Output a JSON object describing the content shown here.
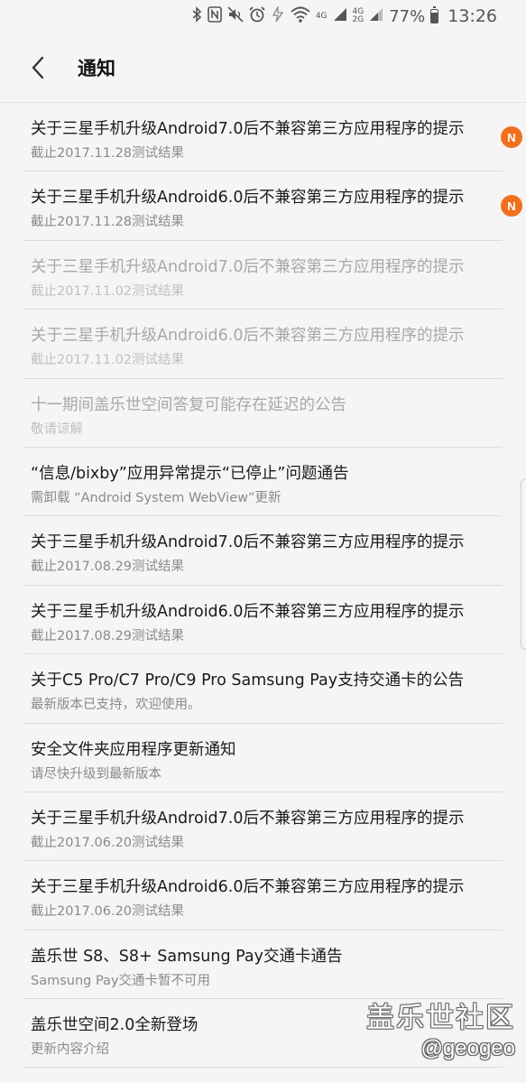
{
  "status_bar": {
    "battery_percent": "77%",
    "battery_level": 0.77,
    "network_top": "4G",
    "network_mid": "4G",
    "network_bottom": "2G",
    "time": "13:26",
    "icons": [
      "bluetooth-icon",
      "nfc-icon",
      "mute-icon",
      "alarm-icon",
      "data-saver-icon",
      "wifi-icon",
      "signal-4g-icon",
      "signal-2g-icon",
      "battery-icon"
    ]
  },
  "header": {
    "title": "通知",
    "back_icon": "chevron-left-icon"
  },
  "notifications": [
    {
      "title": "关于三星手机升级Android7.0后不兼容第三方应用程序的提示",
      "subtitle": "截止2017.11.28测试结果",
      "read": false,
      "badge": "N"
    },
    {
      "title": "关于三星手机升级Android6.0后不兼容第三方应用程序的提示",
      "subtitle": "截止2017.11.28测试结果",
      "read": false,
      "badge": "N"
    },
    {
      "title": "关于三星手机升级Android7.0后不兼容第三方应用程序的提示",
      "subtitle": "截止2017.11.02测试结果",
      "read": true,
      "badge": ""
    },
    {
      "title": "关于三星手机升级Android6.0后不兼容第三方应用程序的提示",
      "subtitle": "截止2017.11.02测试结果",
      "read": true,
      "badge": ""
    },
    {
      "title": "十一期间盖乐世空间答复可能存在延迟的公告",
      "subtitle": "敬请谅解",
      "read": true,
      "badge": ""
    },
    {
      "title": "“信息/bixby”应用异常提示“已停止”问题通告",
      "subtitle": "需卸载 “Android System WebView”更新",
      "read": false,
      "badge": ""
    },
    {
      "title": "关于三星手机升级Android7.0后不兼容第三方应用程序的提示",
      "subtitle": "截止2017.08.29测试结果",
      "read": false,
      "badge": ""
    },
    {
      "title": "关于三星手机升级Android6.0后不兼容第三方应用程序的提示",
      "subtitle": "截止2017.08.29测试结果",
      "read": false,
      "badge": ""
    },
    {
      "title": "关于C5 Pro/C7 Pro/C9 Pro Samsung Pay支持交通卡的公告",
      "subtitle": "最新版本已支持，欢迎使用。",
      "read": false,
      "badge": ""
    },
    {
      "title": "安全文件夹应用程序更新通知",
      "subtitle": "请尽快升级到最新版本",
      "read": false,
      "badge": ""
    },
    {
      "title": "关于三星手机升级Android7.0后不兼容第三方应用程序的提示",
      "subtitle": "截止2017.06.20测试结果",
      "read": false,
      "badge": ""
    },
    {
      "title": "关于三星手机升级Android6.0后不兼容第三方应用程序的提示",
      "subtitle": "截止2017.06.20测试结果",
      "read": false,
      "badge": ""
    },
    {
      "title": "盖乐世 S8、S8+ Samsung Pay交通卡通告",
      "subtitle": "Samsung Pay交通卡暂不可用",
      "read": false,
      "badge": ""
    },
    {
      "title": "盖乐世空间2.0全新登场",
      "subtitle": "更新内容介绍",
      "read": false,
      "badge": ""
    }
  ],
  "watermark": {
    "line1": "盖乐世社区",
    "line2": "@geogeo"
  },
  "colors": {
    "background": "#f5f5f5",
    "badge": "#f0701e",
    "read_text": "#a8a8a8",
    "subtitle_text": "#8a8a8a"
  }
}
